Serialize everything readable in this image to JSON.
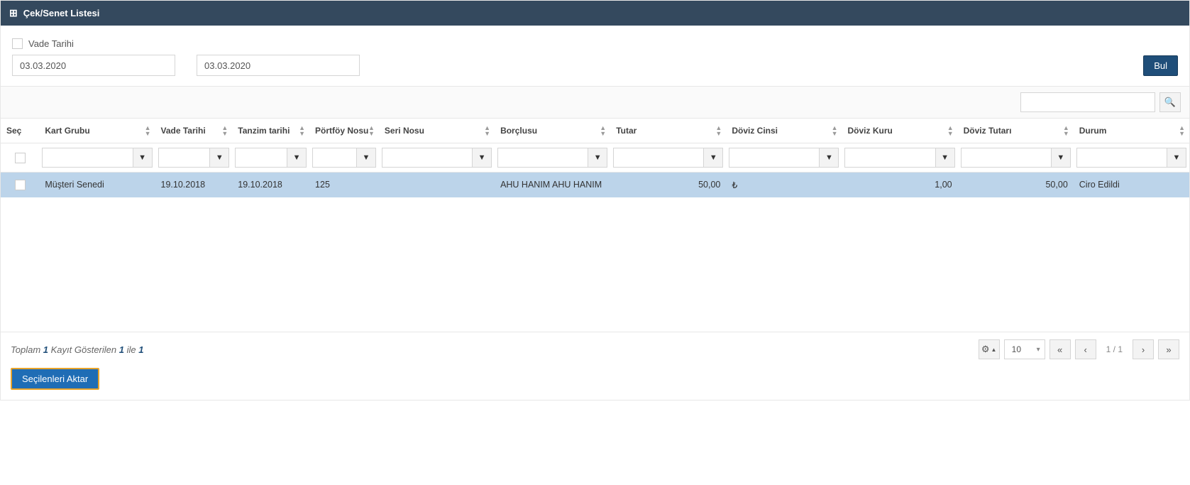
{
  "header": {
    "title": "Çek/Senet Listesi"
  },
  "filter": {
    "vade_label": "Vade Tarihi",
    "date_from": "03.03.2020",
    "date_to": "03.03.2020",
    "search_btn": "Bul"
  },
  "columns": {
    "sec": "Seç",
    "kart_grubu": "Kart Grubu",
    "vade_tarihi": "Vade Tarihi",
    "tanzim_tarihi": "Tanzim tarihi",
    "portfoy_nosu": "Pörtföy Nosu",
    "seri_nosu": "Seri Nosu",
    "borclu": "Borçlusu",
    "tutar": "Tutar",
    "doviz_cinsi": "Döviz Cinsi",
    "doviz_kuru": "Döviz Kuru",
    "doviz_tutari": "Döviz Tutarı",
    "durum": "Durum"
  },
  "rows": [
    {
      "kart_grubu": "Müşteri Senedi",
      "vade_tarihi": "19.10.2018",
      "tanzim_tarihi": "19.10.2018",
      "portfoy_nosu": "125",
      "seri_nosu": "",
      "borclu": "AHU HANIM AHU HANIM",
      "tutar": "50,00",
      "doviz_cinsi": "₺",
      "doviz_kuru": "1,00",
      "doviz_tutari": "50,00",
      "durum": "Ciro Edildi"
    }
  ],
  "footer": {
    "summary_prefix": "Toplam ",
    "summary_total": "1",
    "summary_mid": " Kayıt Gösterilen ",
    "summary_shown": "1",
    "summary_sep": " ile ",
    "summary_end": "1",
    "page_size": "10",
    "page_indicator": "1 / 1",
    "transfer_btn": "Seçilenleri Aktar"
  }
}
